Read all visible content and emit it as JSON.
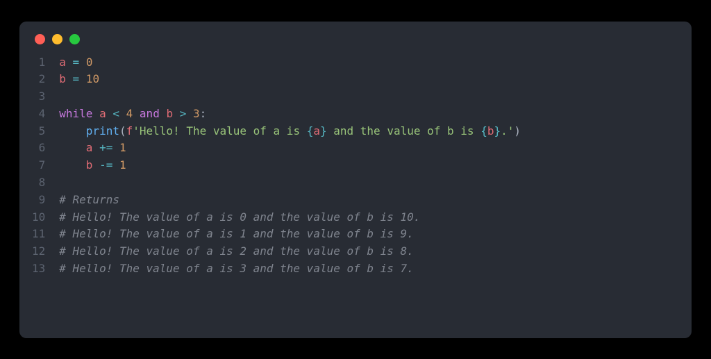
{
  "window": {
    "traffic": {
      "red": "#ff5f56",
      "yellow": "#ffbd2e",
      "green": "#27c93f"
    }
  },
  "code": {
    "lines": [
      {
        "n": "1",
        "tokens": [
          [
            "var",
            "a"
          ],
          [
            "pn",
            " "
          ],
          [
            "op",
            "="
          ],
          [
            "pn",
            " "
          ],
          [
            "num",
            "0"
          ]
        ]
      },
      {
        "n": "2",
        "tokens": [
          [
            "var",
            "b"
          ],
          [
            "pn",
            " "
          ],
          [
            "op",
            "="
          ],
          [
            "pn",
            " "
          ],
          [
            "num",
            "10"
          ]
        ]
      },
      {
        "n": "3",
        "tokens": []
      },
      {
        "n": "4",
        "tokens": [
          [
            "kw",
            "while"
          ],
          [
            "pn",
            " "
          ],
          [
            "var",
            "a"
          ],
          [
            "pn",
            " "
          ],
          [
            "op",
            "<"
          ],
          [
            "pn",
            " "
          ],
          [
            "num",
            "4"
          ],
          [
            "pn",
            " "
          ],
          [
            "kw",
            "and"
          ],
          [
            "pn",
            " "
          ],
          [
            "var",
            "b"
          ],
          [
            "pn",
            " "
          ],
          [
            "op",
            ">"
          ],
          [
            "pn",
            " "
          ],
          [
            "num",
            "3"
          ],
          [
            "pn",
            ":"
          ]
        ]
      },
      {
        "n": "5",
        "tokens": [
          [
            "pn",
            "    "
          ],
          [
            "fn",
            "print"
          ],
          [
            "pn",
            "("
          ],
          [
            "var",
            "f"
          ],
          [
            "str",
            "'Hello! The value of a is "
          ],
          [
            "str-br",
            "{"
          ],
          [
            "str-int",
            "a"
          ],
          [
            "str-br",
            "}"
          ],
          [
            "str",
            " and the value of b is "
          ],
          [
            "str-br",
            "{"
          ],
          [
            "str-int",
            "b"
          ],
          [
            "str-br",
            "}"
          ],
          [
            "str",
            ".'"
          ],
          [
            "pn",
            ")"
          ]
        ]
      },
      {
        "n": "6",
        "tokens": [
          [
            "pn",
            "    "
          ],
          [
            "var",
            "a"
          ],
          [
            "pn",
            " "
          ],
          [
            "op",
            "+="
          ],
          [
            "pn",
            " "
          ],
          [
            "num",
            "1"
          ]
        ]
      },
      {
        "n": "7",
        "tokens": [
          [
            "pn",
            "    "
          ],
          [
            "var",
            "b"
          ],
          [
            "pn",
            " "
          ],
          [
            "op",
            "-="
          ],
          [
            "pn",
            " "
          ],
          [
            "num",
            "1"
          ]
        ]
      },
      {
        "n": "8",
        "tokens": []
      },
      {
        "n": "9",
        "tokens": [
          [
            "cm",
            "# Returns"
          ]
        ]
      },
      {
        "n": "10",
        "tokens": [
          [
            "cm",
            "# Hello! The value of a is 0 and the value of b is 10."
          ]
        ]
      },
      {
        "n": "11",
        "tokens": [
          [
            "cm",
            "# Hello! The value of a is 1 and the value of b is 9."
          ]
        ]
      },
      {
        "n": "12",
        "tokens": [
          [
            "cm",
            "# Hello! The value of a is 2 and the value of b is 8."
          ]
        ]
      },
      {
        "n": "13",
        "tokens": [
          [
            "cm",
            "# Hello! The value of a is 3 and the value of b is 7."
          ]
        ]
      }
    ]
  }
}
